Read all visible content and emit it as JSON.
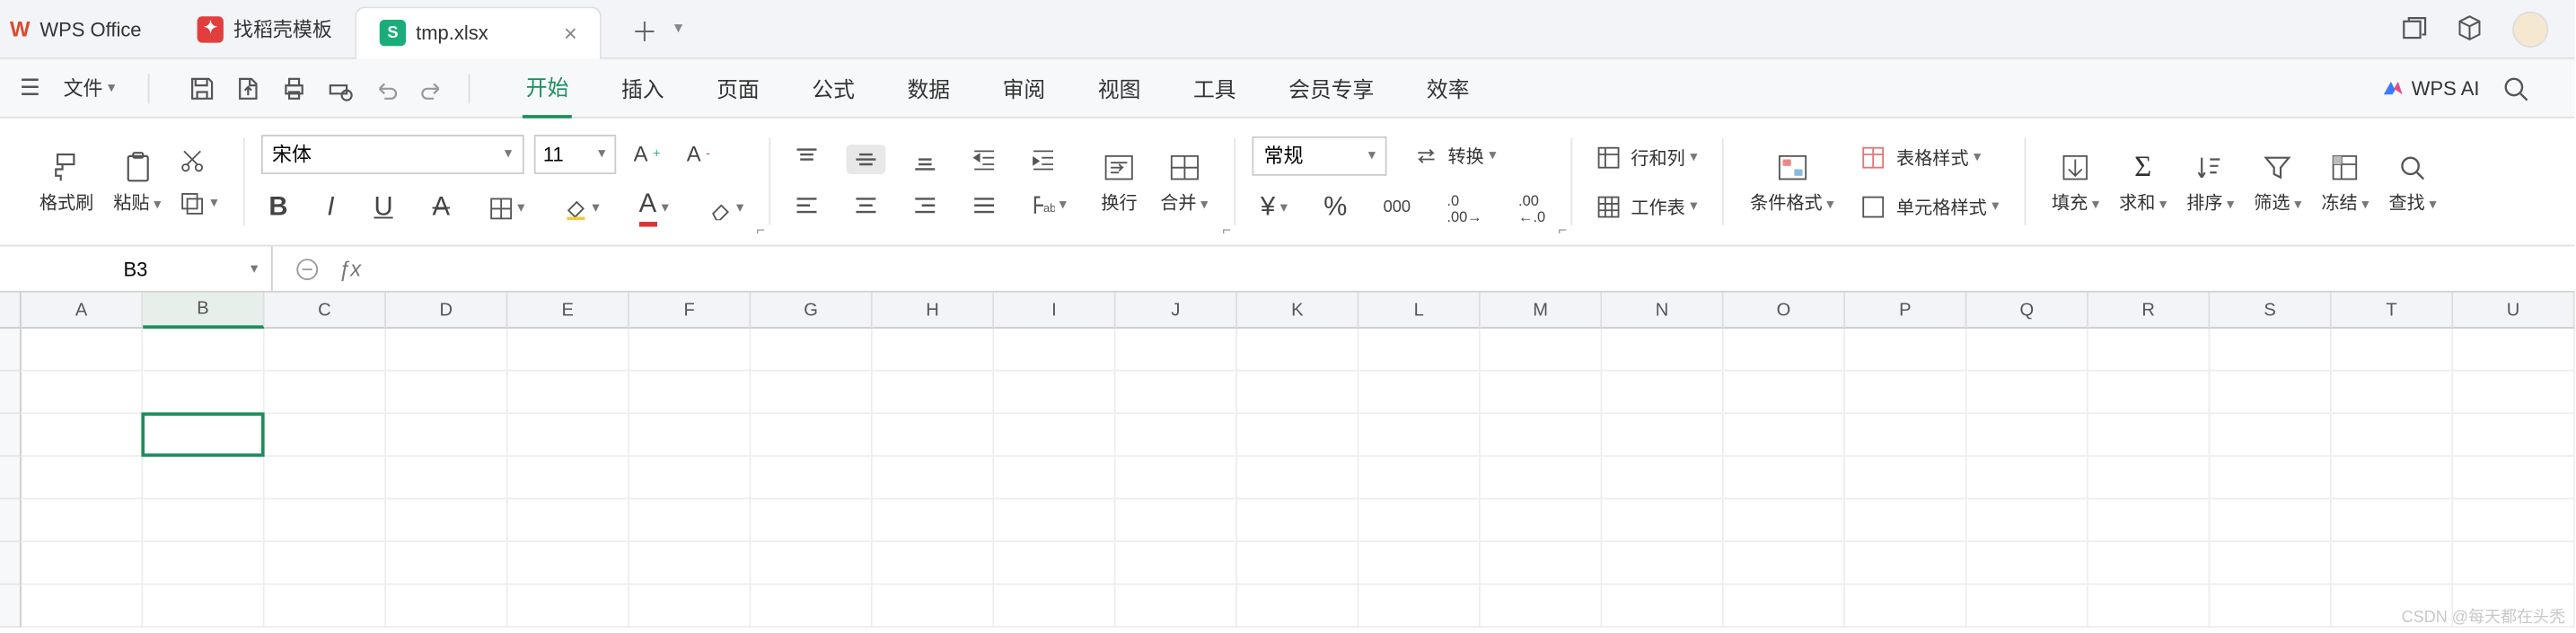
{
  "titlebar": {
    "app_name": "WPS Office",
    "tabs": {
      "docer": "找稻壳模板",
      "file": "tmp.xlsx"
    }
  },
  "menubar": {
    "file": "文件",
    "ribbon_tabs": [
      "开始",
      "插入",
      "页面",
      "公式",
      "数据",
      "审阅",
      "视图",
      "工具",
      "会员专享",
      "效率"
    ],
    "wps_ai": "WPS AI"
  },
  "ribbon": {
    "format_painter": "格式刷",
    "paste": "粘贴",
    "font_name": "宋体",
    "font_size": "11",
    "wrap": "换行",
    "merge": "合并",
    "number_format": "常规",
    "convert": "转换",
    "rowcol": "行和列",
    "worksheet": "工作表",
    "cond_fmt": "条件格式",
    "table_style": "表格样式",
    "cell_style": "单元格样式",
    "fill": "填充",
    "sum": "求和",
    "sort": "排序",
    "filter": "筛选",
    "freeze": "冻结",
    "find": "查找"
  },
  "namebox": {
    "value": "B3"
  },
  "columns": [
    "A",
    "B",
    "C",
    "D",
    "E",
    "F",
    "G",
    "H",
    "I",
    "J",
    "K",
    "L",
    "M",
    "N",
    "O",
    "P",
    "Q",
    "R",
    "S",
    "T",
    "U"
  ],
  "selected_col_index": 1,
  "selected_row_index": 2,
  "watermark": "CSDN @每天都在头秃"
}
